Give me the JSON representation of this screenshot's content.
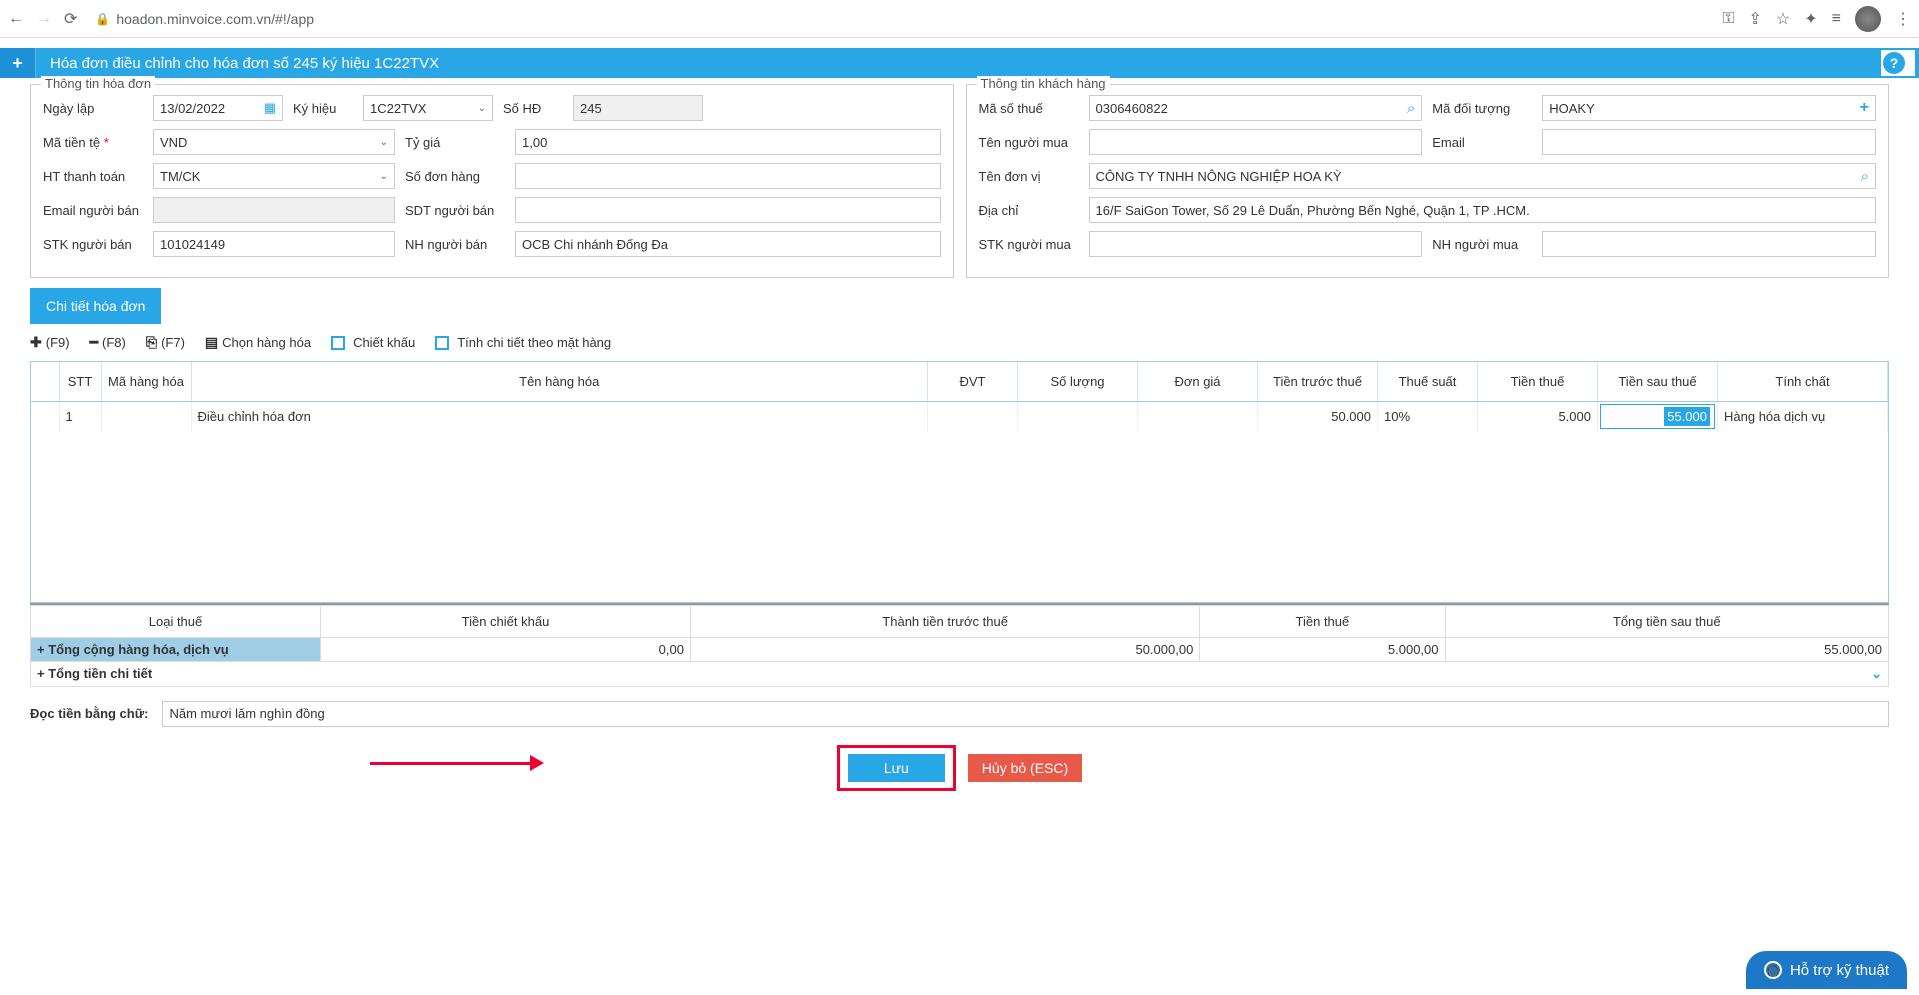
{
  "browser": {
    "url": "hoadon.minvoice.com.vn/#!/app"
  },
  "header": {
    "title": "Hóa đơn điều chỉnh cho hóa đơn số 245 ký hiệu 1C22TVX"
  },
  "invoice_fieldset": {
    "legend": "Thông tin hóa đơn",
    "labels": {
      "ngay_lap": "Ngày lập",
      "ky_hieu": "Ký hiệu",
      "so_hd": "Số HĐ",
      "ma_tien_te": "Mã tiền tệ",
      "ty_gia": "Tỷ giá",
      "ht_thanh_toan": "HT thanh toán",
      "so_don_hang": "Số đơn hàng",
      "email_nguoi_ban": "Email người bán",
      "sdt_nguoi_ban": "SDT người bán",
      "stk_nguoi_ban": "STK người bán",
      "nh_nguoi_ban": "NH người bán"
    },
    "values": {
      "ngay_lap": "13/02/2022",
      "ky_hieu": "1C22TVX",
      "so_hd": "245",
      "ma_tien_te": "VND",
      "ty_gia": "1,00",
      "ht_thanh_toan": "TM/CK",
      "so_don_hang": "",
      "email_nguoi_ban": "",
      "sdt_nguoi_ban": "",
      "stk_nguoi_ban": "101024149",
      "nh_nguoi_ban": "OCB Chi nhánh Đống Đa"
    }
  },
  "customer_fieldset": {
    "legend": "Thông tin khách hàng",
    "labels": {
      "ma_so_thue": "Mã số thuế",
      "ma_doi_tuong": "Mã đối tượng",
      "ten_nguoi_mua": "Tên người mua",
      "email": "Email",
      "ten_don_vi": "Tên đơn vị",
      "dia_chi": "Địa chỉ",
      "stk_nguoi_mua": "STK người mua",
      "nh_nguoi_mua": "NH người mua"
    },
    "values": {
      "ma_so_thue": "0306460822",
      "ma_doi_tuong": "HOAKY",
      "ten_nguoi_mua": "",
      "email": "",
      "ten_don_vi": "CÔNG TY TNHH NÔNG NGHIỆP HOA KỲ",
      "dia_chi": "16/F SaiGon Tower, Số 29 Lê Duẩn, Phường Bến Nghé, Quận 1, TP .HCM.",
      "stk_nguoi_mua": "",
      "nh_nguoi_mua": ""
    }
  },
  "tab": {
    "label": "Chi tiết hóa đơn"
  },
  "toolbar": {
    "add": "(F9)",
    "remove": "(F8)",
    "copy": "(F7)",
    "chon_hang": "Chọn hàng hóa",
    "chiet_khau": "Chiết khấu",
    "tinh_chi_tiet": "Tính chi tiết theo mặt hàng"
  },
  "table": {
    "headers": {
      "stt": "STT",
      "ma_hang": "Mã hàng hóa",
      "ten_hang": "Tên hàng hóa",
      "dvt": "ĐVT",
      "so_luong": "Số lượng",
      "don_gia": "Đơn giá",
      "tien_truoc_thue": "Tiền trước thuế",
      "thue_suat": "Thuế suất",
      "tien_thue": "Tiền thuế",
      "tien_sau_thue": "Tiền sau thuế",
      "tinh_chat": "Tính chất"
    },
    "rows": [
      {
        "stt": "1",
        "ma_hang": "",
        "ten_hang": "Điều chỉnh hóa đơn",
        "dvt": "",
        "so_luong": "",
        "don_gia": "",
        "tien_truoc_thue": "50.000",
        "thue_suat": "10%",
        "tien_thue": "5.000",
        "tien_sau_thue": "55.000",
        "tinh_chat": "Hàng hóa dịch vụ"
      }
    ]
  },
  "summary": {
    "headers": {
      "loai_thue": "Loại thuế",
      "tien_chiet_khau": "Tiền chiết khấu",
      "thanh_tien_truoc_thue": "Thành tiền trước thuế",
      "tien_thue": "Tiền thuế",
      "tong_sau_thue": "Tổng tiền sau thuế"
    },
    "row1_label": "+ Tổng cộng hàng hóa, dịch vụ",
    "row1": {
      "ck": "0,00",
      "tt": "50.000,00",
      "thue": "5.000,00",
      "tong": "55.000,00"
    },
    "row2_label": "+ Tổng tiền chi tiết"
  },
  "words": {
    "label": "Đọc tiền bằng chữ:",
    "value": "Năm mươi lăm nghìn đồng"
  },
  "buttons": {
    "save": "Lưu",
    "cancel": "Hủy bỏ (ESC)"
  },
  "support": {
    "label": "Hỗ trợ kỹ thuật"
  }
}
